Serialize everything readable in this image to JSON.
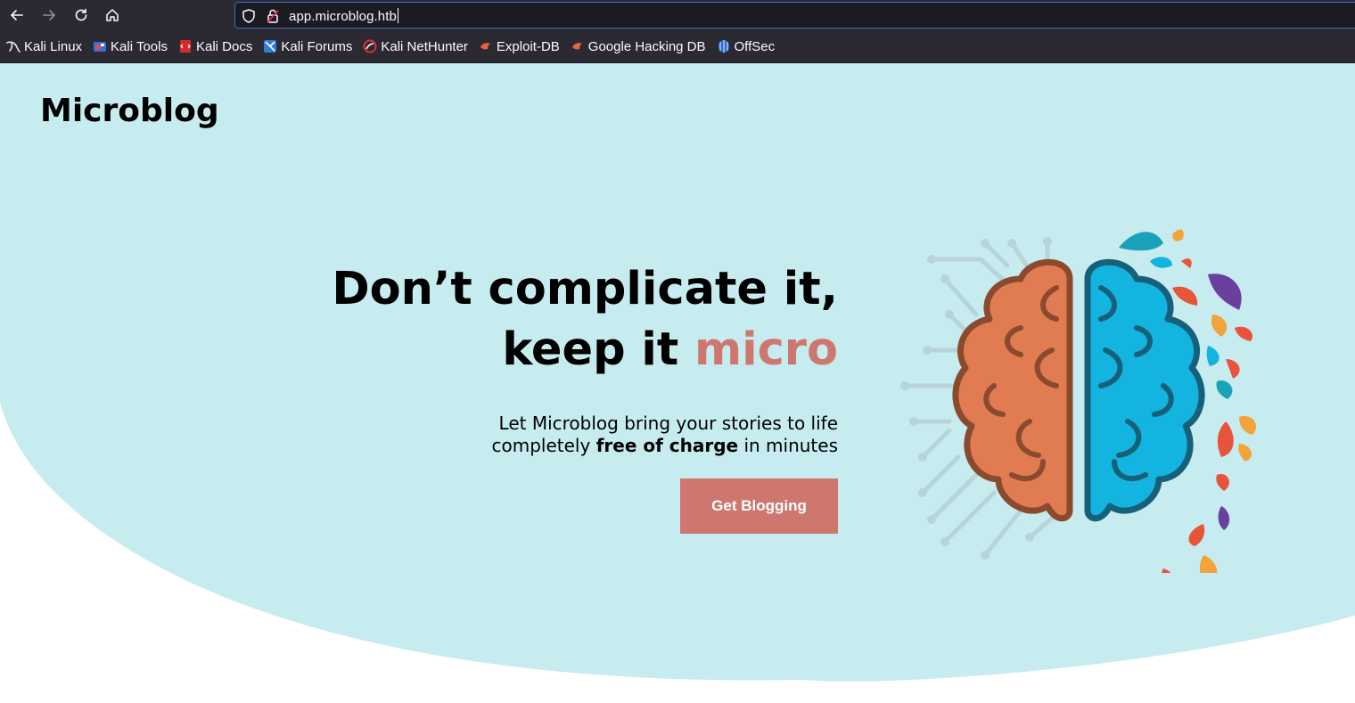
{
  "browser": {
    "url": "app.microblog.htb",
    "bookmarks": [
      {
        "label": "Kali Linux",
        "icon": "kali-dragon-icon"
      },
      {
        "label": "Kali Tools",
        "icon": "kali-tools-icon"
      },
      {
        "label": "Kali Docs",
        "icon": "kali-docs-icon"
      },
      {
        "label": "Kali Forums",
        "icon": "kali-forums-icon"
      },
      {
        "label": "Kali NetHunter",
        "icon": "kali-nethunter-icon"
      },
      {
        "label": "Exploit-DB",
        "icon": "exploit-db-icon"
      },
      {
        "label": "Google Hacking DB",
        "icon": "ghdb-icon"
      },
      {
        "label": "OffSec",
        "icon": "offsec-icon"
      }
    ]
  },
  "site": {
    "brand": "Microblog",
    "headline_line1": "Don’t complicate it,",
    "headline_line2_prefix": "keep it ",
    "headline_accent": "micro",
    "sub_line1": "Let Microblog bring your stories to life",
    "sub_line2_prefix": "completely ",
    "sub_line2_bold": "free of charge",
    "sub_line2_suffix": " in minutes",
    "cta_label": "Get Blogging"
  },
  "colors": {
    "hero_background": "#c7ecef",
    "accent": "#cd776f",
    "brain_left": "#e07b52",
    "brain_right": "#13b4e0",
    "brain_outline": "#8a4a2e"
  }
}
